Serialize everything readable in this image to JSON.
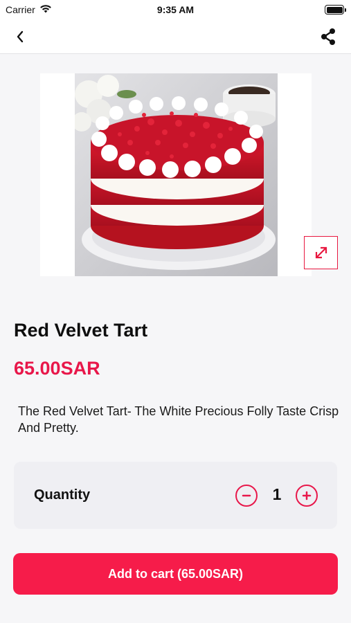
{
  "status_bar": {
    "carrier": "Carrier",
    "time": "9:35 AM"
  },
  "nav": {
    "back_icon": "chevron-left-icon",
    "share_icon": "share-icon"
  },
  "product": {
    "title": "Red Velvet Tart",
    "price": "65.00SAR",
    "description": "The Red Velvet Tart- The White Precious Folly Taste Crisp And Pretty."
  },
  "quantity": {
    "label": "Quantity",
    "value": "1"
  },
  "cart": {
    "add_label": "Add to cart (65.00SAR)"
  },
  "colors": {
    "accent": "#e8174a",
    "button": "#f61c4a",
    "card": "#efeff3",
    "background": "#f6f6f8"
  }
}
